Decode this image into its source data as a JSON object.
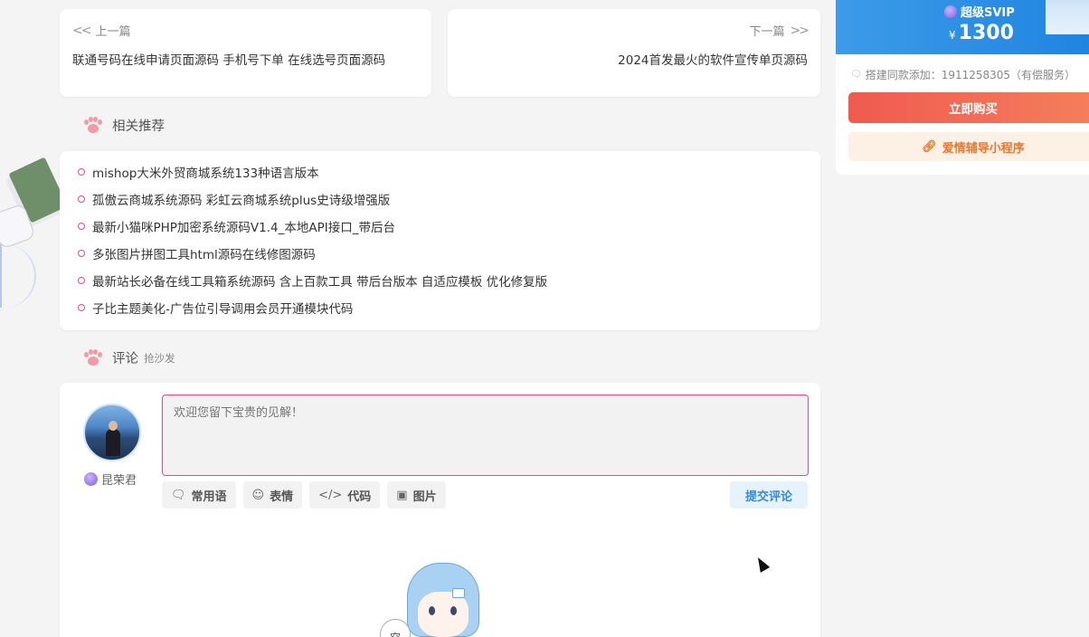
{
  "post_nav": {
    "prev": {
      "hint": "上一篇",
      "title": "联通号码在线申请页面源码 手机号下单 在线选号页面源码"
    },
    "next": {
      "hint": "下一篇",
      "title": "2024首发最火的软件宣传单页源码"
    }
  },
  "related": {
    "heading": "相关推荐",
    "items": [
      "mishop大米外贸商城系统133种语言版本",
      "孤傲云商城系统源码 彩虹云商城系统plus史诗级增强版",
      "最新小猫咪PHP加密系统源码V1.4_本地API接口_带后台",
      "多张图片拼图工具html源码在线修图源码",
      "最新站长必备在线工具箱系统源码 含上百款工具 带后台版本 自适应模板 优化修复版",
      "子比主题美化-广告位引导调用会员开通模块代码"
    ]
  },
  "comments": {
    "heading": "评论",
    "subheading": "抢沙发",
    "user_name": "昆荣君",
    "placeholder": "欢迎您留下宝贵的见解！",
    "toolbar": {
      "phrases": "常用语",
      "emoji": "表情",
      "code": "代码",
      "image": "图片"
    },
    "submit": "提交评论",
    "empty_bubble": "空"
  },
  "sidebar": {
    "svip_label": "超级SVIP",
    "price_currency": "¥",
    "price": "1300",
    "contact": "搭建同款添加：1911258305（有偿服务）",
    "buy_now": "立即购买",
    "mini_program": "爱情辅导小程序"
  },
  "icons": {
    "prev": "double-chevron-left-icon",
    "next": "double-chevron-right-icon",
    "paw": "paw-icon",
    "chat": "chat-bubble-icon",
    "smile": "smile-icon",
    "code": "code-icon",
    "image": "image-icon",
    "link": "link-icon",
    "gem": "gem-icon"
  },
  "colors": {
    "accent_pink": "#e84a86",
    "svip_blue": "#1e84e0",
    "buy_red": "#f05a4f",
    "mini_orange": "#e8772e",
    "submit_blue": "#2f8ae0"
  }
}
